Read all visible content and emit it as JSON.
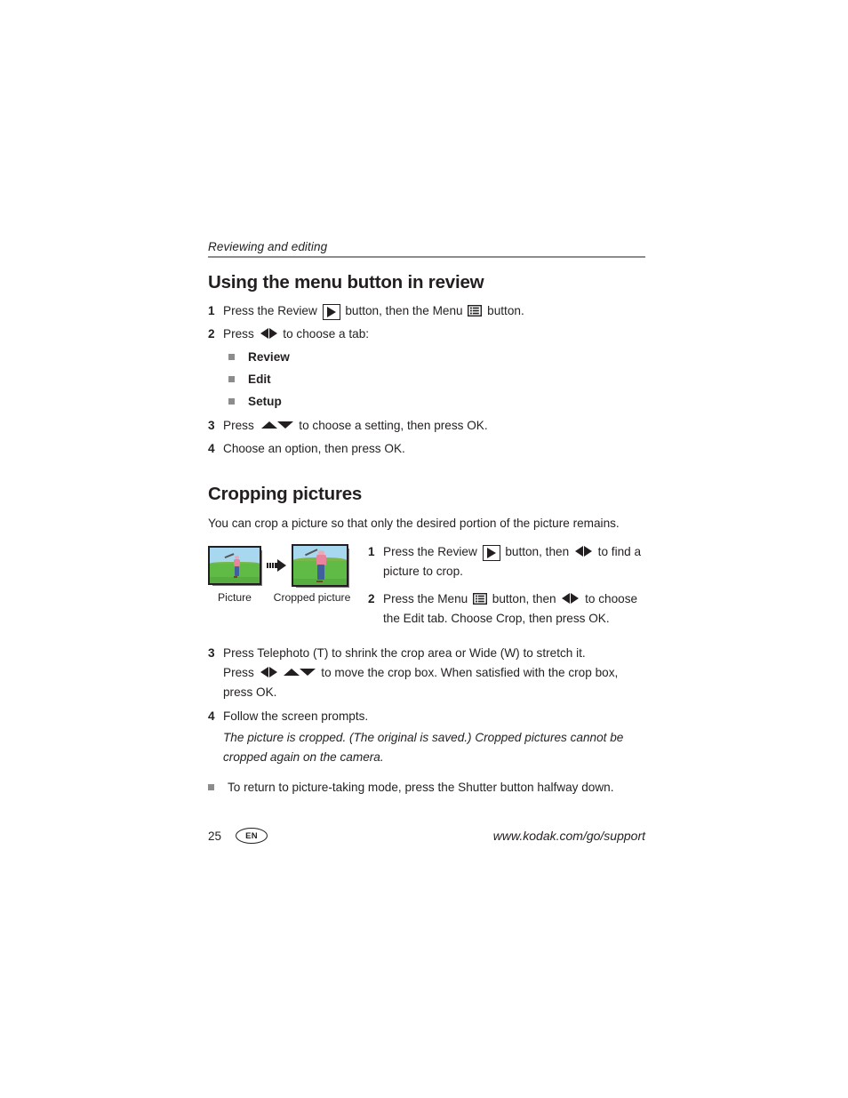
{
  "running_header": "Reviewing and editing",
  "sections": [
    {
      "title": "Using the menu button in review",
      "steps": [
        {
          "num": "1",
          "pre": "Press the Review ",
          "mid": " button, then the Menu ",
          "post": " button."
        },
        {
          "num": "2",
          "pre": "Press ",
          "post": " to choose a tab:"
        },
        {
          "num": "3",
          "pre": "Press ",
          "post": " to choose a setting, then press OK."
        },
        {
          "num": "4",
          "pre": "Choose an option, then press OK."
        }
      ],
      "tabs": [
        "Review",
        "Edit",
        "Setup"
      ]
    },
    {
      "title": "Cropping pictures",
      "intro": "You can crop a picture so that only the desired portion of the picture remains.",
      "figure": {
        "caption_left": "Picture",
        "caption_right": "Cropped picture",
        "arrow_icon": "right-arrow-icon"
      },
      "figure_steps": [
        {
          "num": "1",
          "pre": "Press the Review ",
          "mid": " button, then ",
          "post": " to find a picture to crop."
        },
        {
          "num": "2",
          "pre": "Press the Menu ",
          "mid": " button, then ",
          "post": " to choose the Edit tab. Choose Crop, then press OK."
        }
      ],
      "steps": [
        {
          "num": "3",
          "line1": "Press Telephoto (T) to shrink the crop area or Wide (W) to stretch it.",
          "pre": "Press ",
          "post": " to move the crop box. When satisfied with the crop box, press OK."
        },
        {
          "num": "4",
          "line1": "Follow the screen prompts.",
          "note": "The picture is cropped. (The original is saved.) Cropped pictures cannot be cropped again on the camera."
        }
      ],
      "final_bullet": "To return to picture-taking mode, press the Shutter button halfway down."
    }
  ],
  "footer": {
    "page_number": "25",
    "language": "EN",
    "url": "www.kodak.com/go/support"
  },
  "colors": {
    "rule": "#8c8c8c",
    "bullet": "#8c8c8c",
    "text": "#231f20",
    "sky": "#a8d8f0",
    "grass": "#5fbb46",
    "shirt": "#e8849c",
    "jeans": "#3f5f9f"
  }
}
